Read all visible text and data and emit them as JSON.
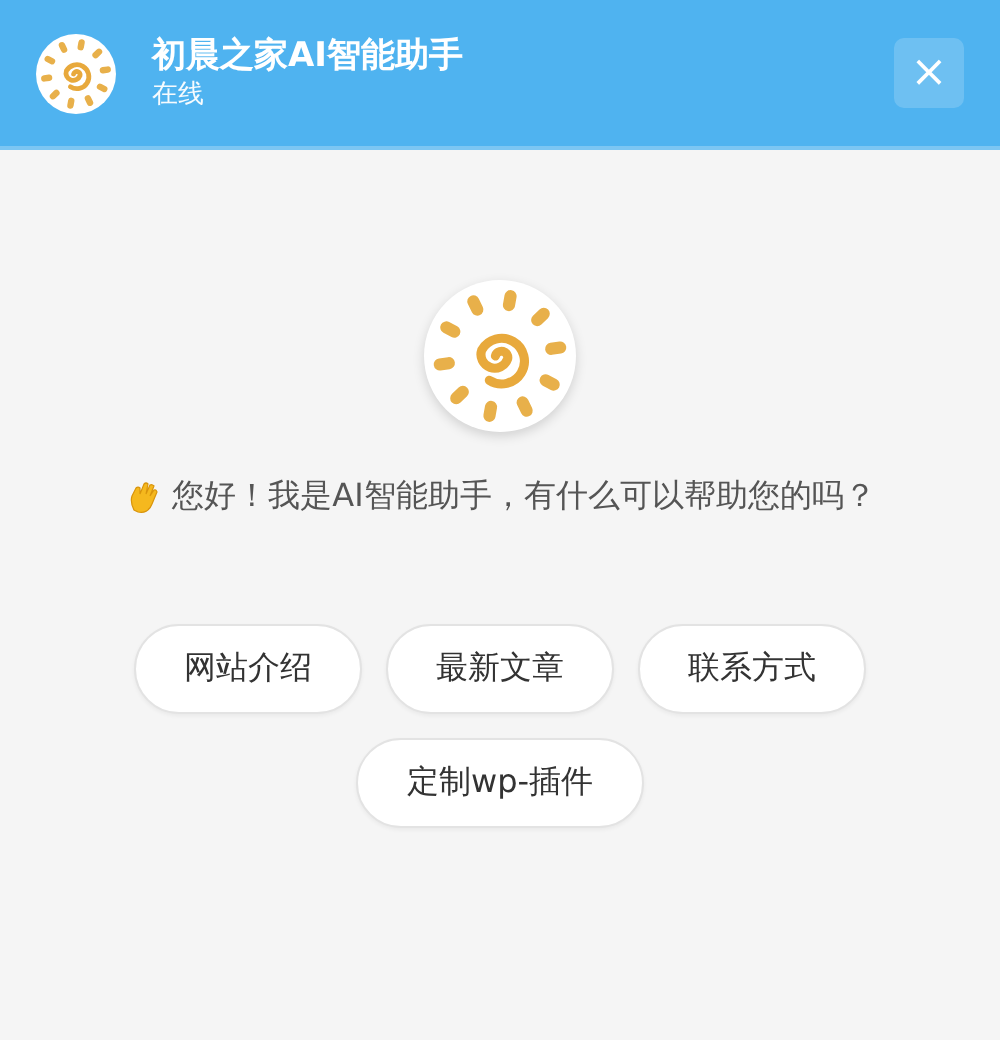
{
  "header": {
    "title": "初晨之家AI智能助手",
    "status": "在线",
    "close_label": "×"
  },
  "greeting": "您好！我是AI智能助手，有什么可以帮助您的吗？",
  "quick_replies": [
    "网站介绍",
    "最新文章",
    "联系方式",
    "定制wp-插件"
  ]
}
